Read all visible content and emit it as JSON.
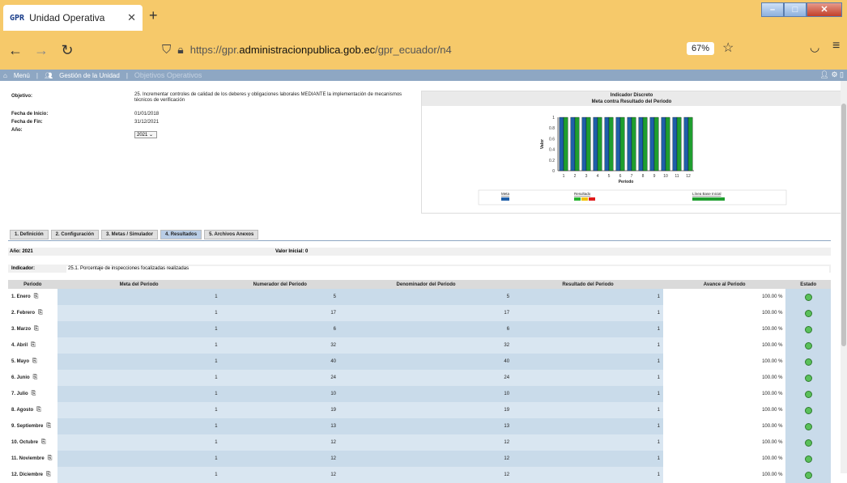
{
  "browser": {
    "tab_title": "Unidad Operativa",
    "tab_favicon": "GPR",
    "url_prefix": "https://gpr.",
    "url_host": "administracionpublica.gob.ec",
    "url_path": "/gpr_ecuador/n4",
    "zoom": "67%"
  },
  "appbar": {
    "menu_label": "Menú",
    "gestion_label": "Gestión de la Unidad",
    "objetivos_label": "Objetivos Operativos"
  },
  "info": {
    "objetivo_label": "Objetivo:",
    "objetivo_value": "25. Incrementar controles de calidad de los deberes y obligaciones laborales MEDIANTE la implementación de mecanismos técnicos de verificación",
    "inicio_label": "Fecha de Inicio:",
    "inicio_value": "01/01/2018",
    "fin_label": "Fecha de Fin:",
    "fin_value": "31/12/2021",
    "anio_label": "Año:",
    "anio_value": "2021"
  },
  "chart_data": {
    "type": "bar",
    "title": "Indicador Discreto",
    "subtitle": "Meta contra Resultado del Periodo",
    "xlabel": "Periodo",
    "ylabel": "Valor",
    "categories": [
      "1",
      "2",
      "3",
      "4",
      "5",
      "6",
      "7",
      "8",
      "9",
      "10",
      "11",
      "12"
    ],
    "series": [
      {
        "name": "Meta",
        "values": [
          1,
          1,
          1,
          1,
          1,
          1,
          1,
          1,
          1,
          1,
          1,
          1
        ],
        "color": "#1f5fa8"
      },
      {
        "name": "Resultado",
        "values": [
          1,
          1,
          1,
          1,
          1,
          1,
          1,
          1,
          1,
          1,
          1,
          1
        ],
        "color": "#1f9e2f"
      }
    ],
    "yticks": [
      "0",
      "0.2",
      "0.4",
      "0.6",
      "0.8",
      "1"
    ],
    "ylim": [
      0,
      1
    ],
    "legend": {
      "meta": "Meta",
      "resultado": "Resultado",
      "linea_base": "Línea Base Inicial"
    }
  },
  "tabs": [
    "1. Definición",
    "2. Configuración",
    "3. Metas / Simulador",
    "4. Resultados",
    "5. Archivos Anexos"
  ],
  "summary": {
    "anio": "Año: 2021",
    "valor_inicial": "Valor Inicial: 0",
    "indicador_label": "Indicador:",
    "indicador_value": "25.1. Porcentaje de inspecciones focalizadas realizadas"
  },
  "table": {
    "headers": [
      "Periodo",
      "Meta del Periodo",
      "Numerador del Periodo",
      "Denominador del Periodo",
      "Resultado del Periodo",
      "Avance al Periodo",
      "Estado"
    ],
    "rows": [
      {
        "periodo": "1. Enero",
        "meta": "1",
        "num": "5",
        "den": "5",
        "res": "1",
        "avance": "100.00 %"
      },
      {
        "periodo": "2. Febrero",
        "meta": "1",
        "num": "17",
        "den": "17",
        "res": "1",
        "avance": "100.00 %"
      },
      {
        "periodo": "3. Marzo",
        "meta": "1",
        "num": "6",
        "den": "6",
        "res": "1",
        "avance": "100.00 %"
      },
      {
        "periodo": "4. Abril",
        "meta": "1",
        "num": "32",
        "den": "32",
        "res": "1",
        "avance": "100.00 %"
      },
      {
        "periodo": "5. Mayo",
        "meta": "1",
        "num": "40",
        "den": "40",
        "res": "1",
        "avance": "100.00 %"
      },
      {
        "periodo": "6. Junio",
        "meta": "1",
        "num": "24",
        "den": "24",
        "res": "1",
        "avance": "100.00 %"
      },
      {
        "periodo": "7. Julio",
        "meta": "1",
        "num": "10",
        "den": "10",
        "res": "1",
        "avance": "100.00 %"
      },
      {
        "periodo": "8. Agosto",
        "meta": "1",
        "num": "19",
        "den": "19",
        "res": "1",
        "avance": "100.00 %"
      },
      {
        "periodo": "9. Septiembre",
        "meta": "1",
        "num": "13",
        "den": "13",
        "res": "1",
        "avance": "100.00 %"
      },
      {
        "periodo": "10. Octubre",
        "meta": "1",
        "num": "12",
        "den": "12",
        "res": "1",
        "avance": "100.00 %"
      },
      {
        "periodo": "11. Noviembre",
        "meta": "1",
        "num": "12",
        "den": "12",
        "res": "1",
        "avance": "100.00 %"
      },
      {
        "periodo": "12. Diciembre",
        "meta": "1",
        "num": "12",
        "den": "12",
        "res": "1",
        "avance": "100.00 %"
      }
    ]
  }
}
